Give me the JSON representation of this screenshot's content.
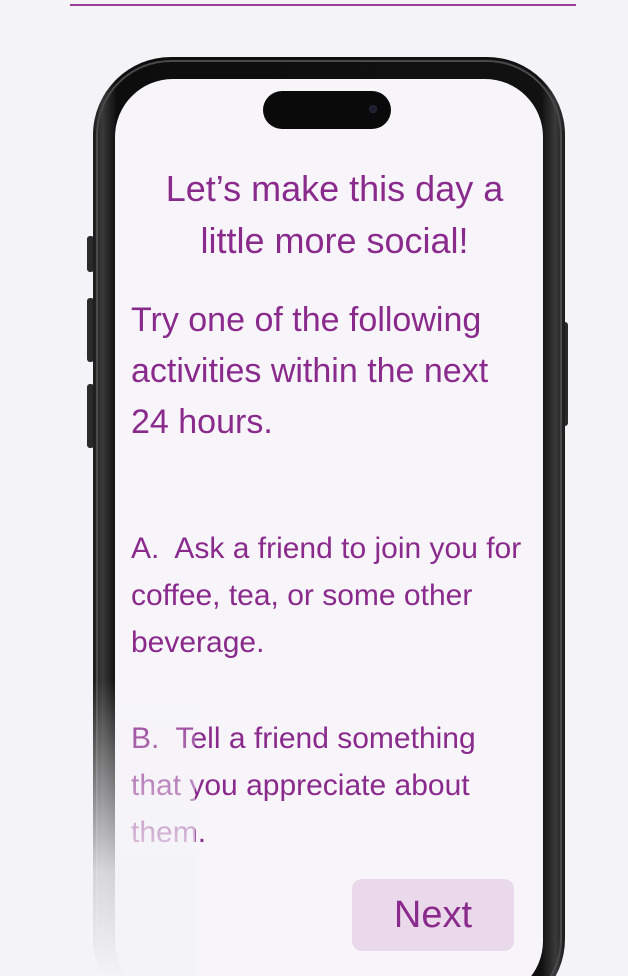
{
  "screen": {
    "headline": "Let’s make this day a little more social!",
    "instruction": "Try one of the following activities within the next 24 hours.",
    "activities": [
      {
        "label": "A.",
        "text": "Ask a friend to join you for coffee, tea, or some other beverage."
      },
      {
        "label": "B.",
        "text": "Tell a friend something that you appreciate about them."
      }
    ],
    "next_label": "Next"
  },
  "colors": {
    "accent": "#8a2a8c",
    "button_bg": "#ead9ea",
    "screen_bg": "#f7f5fa",
    "page_bg": "#f4f3f7"
  }
}
